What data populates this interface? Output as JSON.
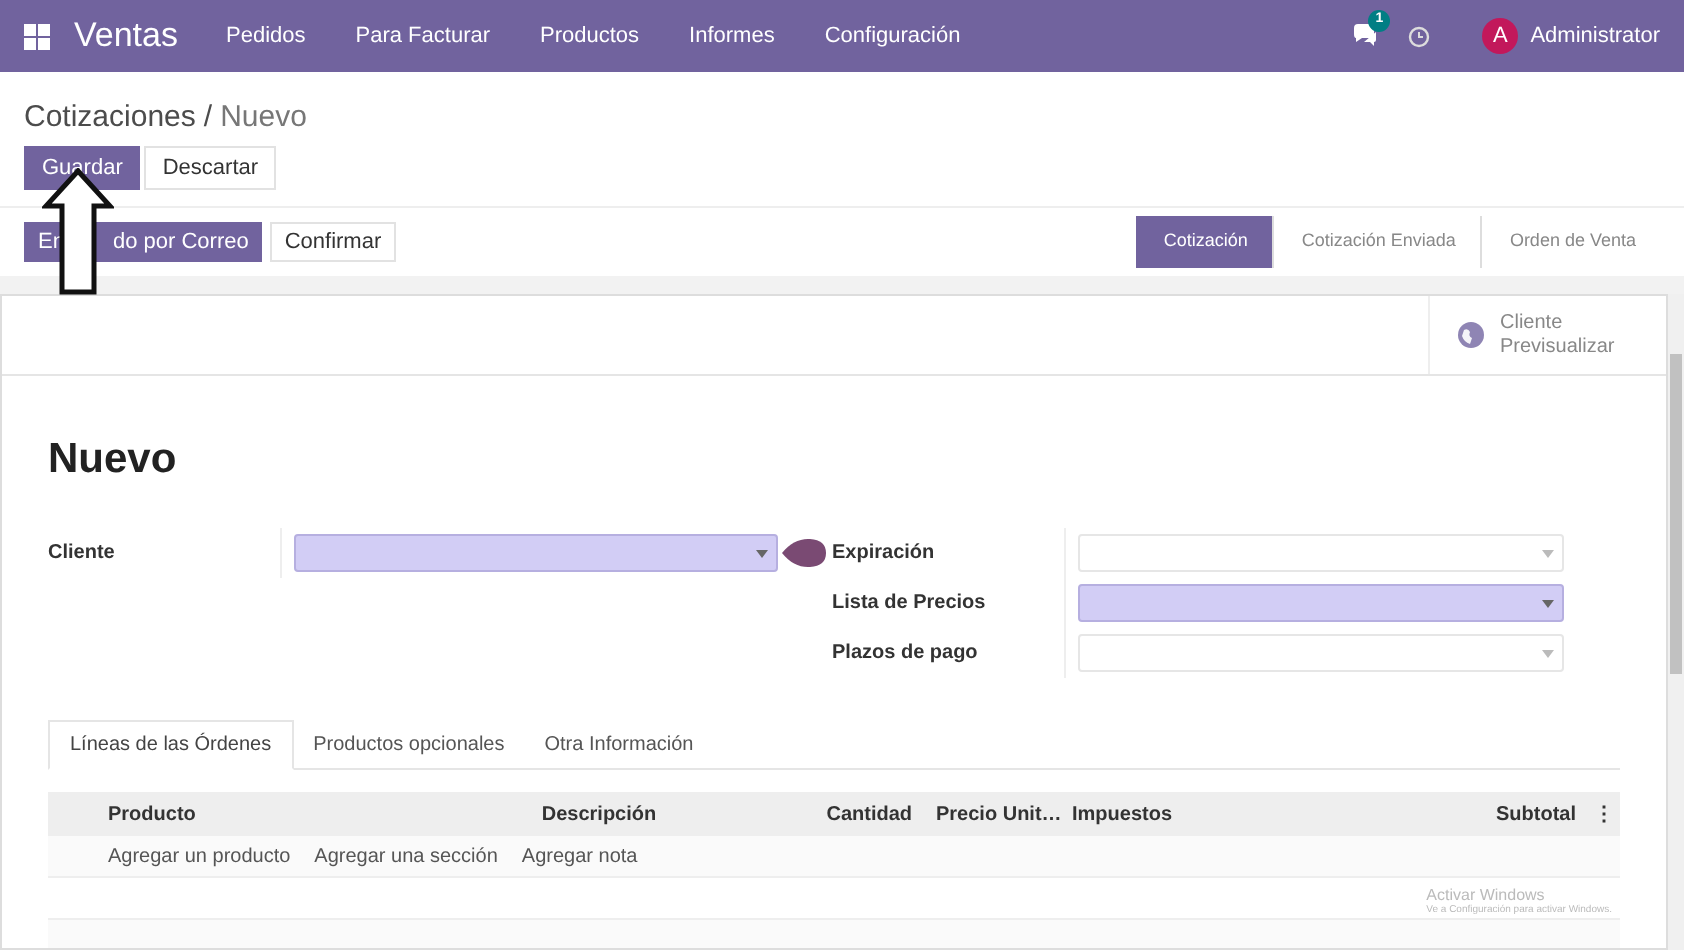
{
  "navbar": {
    "app": "Ventas",
    "menu": [
      "Pedidos",
      "Para Facturar",
      "Productos",
      "Informes",
      "Configuración"
    ],
    "messages_badge": "1",
    "user_initial": "A",
    "user": "Administrator"
  },
  "breadcrumb": {
    "parent": "Cotizaciones",
    "separator": "/",
    "current": "Nuevo"
  },
  "actions": [
    {
      "label": "Guardar",
      "kind": "primary"
    },
    {
      "label": "Descartar",
      "kind": "secondary"
    }
  ],
  "status_actions": [
    {
      "label_before": "En",
      "label_after": "do por Correo",
      "kind": "primary"
    },
    {
      "label": "Confirmar",
      "kind": "secondary"
    }
  ],
  "stages": [
    {
      "label": "Cotización",
      "selected": true
    },
    {
      "label": "Cotización Enviada",
      "selected": false
    },
    {
      "label": "Orden de Venta",
      "selected": false
    }
  ],
  "preview_button": [
    "Cliente",
    "Previsualizar"
  ],
  "title": "Nuevo",
  "left_fields": [
    {
      "label": "Cliente",
      "required": true
    }
  ],
  "right_fields": [
    {
      "label": "Expiración",
      "required": false
    },
    {
      "label": "Lista de Precios",
      "required": true
    },
    {
      "label": "Plazos de pago",
      "required": false
    }
  ],
  "tabs": [
    {
      "label": "Líneas de las Órdenes",
      "selected": true
    },
    {
      "label": "Productos opcionales",
      "selected": false
    },
    {
      "label": "Otra Información",
      "selected": false
    }
  ],
  "table": {
    "columns": [
      "Producto",
      "Descripción",
      "Cantidad",
      "Precio Unit…",
      "Impuestos",
      "Subtotal"
    ],
    "options_glyph": "⋮",
    "add_links": [
      "Agregar un producto",
      "Agregar una sección",
      "Agregar nota"
    ]
  },
  "os_notice": [
    "Activar Windows",
    "Ve a Configuración para activar Windows."
  ]
}
